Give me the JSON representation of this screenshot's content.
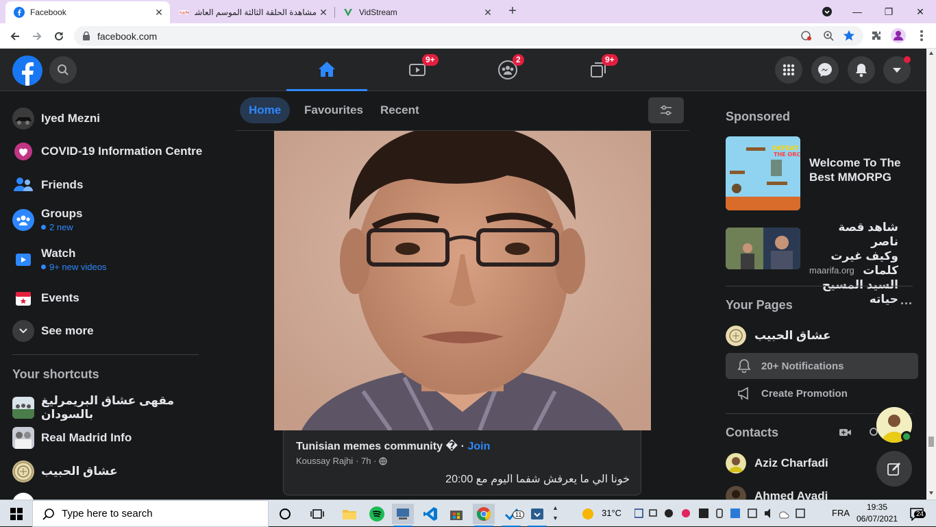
{
  "browser": {
    "tabs": [
      {
        "title": "Facebook",
        "favicon": "facebook-icon"
      },
      {
        "title": "مشاهدة الحلقة الثالثة الموسم العاشر",
        "favicon": "site-icon"
      },
      {
        "title": "VidStream",
        "favicon": "vidstream-icon"
      }
    ],
    "url": "facebook.com"
  },
  "fb_header": {
    "watch_badge": "9+",
    "groups_badge": "2",
    "gaming_badge": "9+"
  },
  "left_nav": {
    "items": [
      {
        "label": "Iyed Mezni"
      },
      {
        "label": "COVID-19 Information Centre"
      },
      {
        "label": "Friends"
      },
      {
        "label": "Groups",
        "sub": "2 new"
      },
      {
        "label": "Watch",
        "sub": "9+ new videos"
      },
      {
        "label": "Events"
      },
      {
        "label": "See more"
      }
    ],
    "shortcuts_title": "Your shortcuts",
    "shortcuts": [
      {
        "label": "مقهى عشاق البريمرليغ بالسودان"
      },
      {
        "label": "Real Madrid Info"
      },
      {
        "label": "عشاق الحبيب"
      }
    ]
  },
  "feed": {
    "tabs": [
      {
        "label": "Home"
      },
      {
        "label": "Favourites"
      },
      {
        "label": "Recent"
      }
    ],
    "post": {
      "group": "Tunisian memes community �",
      "separator": " · ",
      "join": "Join",
      "author": "Koussay Rajhi",
      "time": "· 7h ·",
      "text": "خونا الي ما يعرفش شفما اليوم مع 20:00"
    }
  },
  "right_col": {
    "sponsored_title": "Sponsored",
    "ads": [
      {
        "title_line1": "Welcome To The",
        "title_line2": "Best MMORPG",
        "image_text_1": "DEFEAT",
        "image_text_2": "THE ORC"
      },
      {
        "title_line1": "شاهد قصة ناصر",
        "title_line2": "وكيف غيرت كلمات",
        "title_line3": "السيد المسيح حياته",
        "domain": "maarifa.org"
      }
    ],
    "your_pages_title": "Your Pages",
    "more": "···",
    "page_name": "عشاق الحبيب",
    "page_notifications": "20+ Notifications",
    "page_promotion": "Create Promotion",
    "contacts_title": "Contacts",
    "contacts": [
      {
        "name": "Aziz Charfadi"
      },
      {
        "name": "Ahmed Ayadi"
      }
    ]
  },
  "taskbar": {
    "search_placeholder": "Type here to search",
    "weather": "31°C",
    "language": "FRA",
    "time": "19:35",
    "date": "06/07/2021",
    "notif_count": "24",
    "vscode_badge": "11"
  }
}
